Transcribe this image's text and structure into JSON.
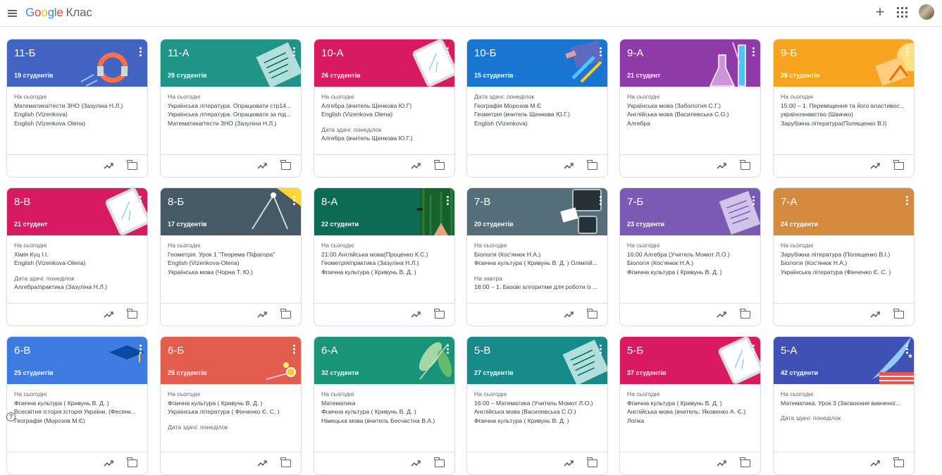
{
  "header": {
    "logo_google": [
      "G",
      "o",
      "o",
      "g",
      "l",
      "e"
    ],
    "app_name": "Клас",
    "add_label": "+"
  },
  "colors": {
    "topbar_border": "#e0e0e0",
    "card_border": "#dadce0"
  },
  "classes": [
    {
      "name": "11-Б",
      "count": "19 студентів",
      "color": "#4364c2",
      "deco": "magnet",
      "lines": [
        {
          "t": "lbl",
          "v": "На сьогодні"
        },
        {
          "t": "ln",
          "v": "Математика/тести ЗНО (Зазуліна Н.Л.)"
        },
        {
          "t": "ln",
          "v": "English (Vizenkova)"
        },
        {
          "t": "ln",
          "v": "English (Vizenkova Olena)"
        }
      ]
    },
    {
      "name": "11-А",
      "count": "29 студентів",
      "color": "#1f9487",
      "deco": "paper",
      "lines": [
        {
          "t": "lbl",
          "v": "На сьогодні"
        },
        {
          "t": "ln",
          "v": "Українська література. Опрацювати стр14..."
        },
        {
          "t": "ln",
          "v": "Українська література. Опрацювати за під..."
        },
        {
          "t": "ln",
          "v": "Математика/тести ЗНО (Зазуліна Н.Л.)"
        }
      ]
    },
    {
      "name": "10-А",
      "count": "26 студентів",
      "color": "#d81b60",
      "deco": "tablet",
      "lines": [
        {
          "t": "lbl",
          "v": "На сьогодні"
        },
        {
          "t": "ln",
          "v": "Алгебра (вчитель Щенкова Ю.Г)"
        },
        {
          "t": "ln",
          "v": "English (Vizenkova Olena)"
        },
        {
          "t": "gap",
          "v": ""
        },
        {
          "t": "lbl",
          "v": "Дата здачі: понеділок"
        },
        {
          "t": "ln",
          "v": "Алгебра (вчитель Щенкова Ю.Г.)"
        }
      ]
    },
    {
      "name": "10-Б",
      "count": "15 студентів",
      "color": "#1976d2",
      "deco": "pencils",
      "lines": [
        {
          "t": "lbl",
          "v": "Дата здачі: понеділок"
        },
        {
          "t": "ln",
          "v": "Географія Морозов М.Є"
        },
        {
          "t": "ln",
          "v": "Геометрія (вчитель Щенкова Ю.Г.)"
        },
        {
          "t": "ln",
          "v": "English (Vizenkova)"
        }
      ]
    },
    {
      "name": "9-А",
      "count": "21 студент",
      "color": "#8e3aa9",
      "deco": "flask",
      "lines": [
        {
          "t": "lbl",
          "v": "На сьогодні"
        },
        {
          "t": "ln",
          "v": "Українська мова (Заболотня С.Г.)"
        },
        {
          "t": "ln",
          "v": "Англійська мова (Василевська С.О.)"
        },
        {
          "t": "ln",
          "v": "Алгебра"
        }
      ]
    },
    {
      "name": "9-Б",
      "count": "26 студентів",
      "color": "#f6a41f",
      "deco": "sun",
      "lines": [
        {
          "t": "lbl",
          "v": "На сьогодні"
        },
        {
          "t": "ln",
          "v": "15:00 – 1. Переміщення та його властивос..."
        },
        {
          "t": "ln",
          "v": "українознавство (Швачко)"
        },
        {
          "t": "ln",
          "v": "Зарубіжна література(Полященко В.І)"
        }
      ]
    },
    {
      "name": "8-В",
      "count": "21 студент",
      "color": "#d81b60",
      "deco": "tablet",
      "lines": [
        {
          "t": "lbl",
          "v": "На сьогодні"
        },
        {
          "t": "ln",
          "v": "Хімія Куц І.І."
        },
        {
          "t": "ln",
          "v": "English (Vizenkova-Olena)"
        },
        {
          "t": "gap",
          "v": ""
        },
        {
          "t": "lbl",
          "v": "Дата здачі: понеділок"
        },
        {
          "t": "ln",
          "v": "Алгебра/практика (Зазуліна Н.Л.)"
        }
      ]
    },
    {
      "name": "8-Б",
      "count": "17 студентів",
      "color": "#455a64",
      "deco": "compass",
      "lines": [
        {
          "t": "lbl",
          "v": "На сьогодні"
        },
        {
          "t": "ln",
          "v": "Геометрія. Урок 1 \"Теорема Піфагора\""
        },
        {
          "t": "ln",
          "v": "English (Vizenkova-Olena)"
        },
        {
          "t": "ln",
          "v": "Українська мова (Чорна Т. Ю.)"
        }
      ]
    },
    {
      "name": "8-А",
      "count": "22 студенти",
      "color": "#0b6b54",
      "deco": "forest",
      "lines": [
        {
          "t": "lbl",
          "v": "На сьогодні"
        },
        {
          "t": "ln",
          "v": "21:00    Англійська мова(Проценко К.С.)"
        },
        {
          "t": "ln",
          "v": "Геометрія/практика (Зазуліна Н.Л.)"
        },
        {
          "t": "ln",
          "v": "Фізична культура ( Кривунь В. Д. )"
        }
      ]
    },
    {
      "name": "7-В",
      "count": "20 студентів",
      "color": "#546e7a",
      "deco": "devices",
      "lines": [
        {
          "t": "lbl",
          "v": "На сьогодні"
        },
        {
          "t": "ln",
          "v": "Біологія (Кос'янюк Н.А.)"
        },
        {
          "t": "ln",
          "v": "Фізична культура ( Кривунь В. Д. ) Олімпій..."
        },
        {
          "t": "gap",
          "v": ""
        },
        {
          "t": "lbl",
          "v": "На завтра"
        },
        {
          "t": "ln",
          "v": "18:00 – 1. Базові алгоритми для роботи із ..."
        }
      ]
    },
    {
      "name": "7-Б",
      "count": "23 студенти",
      "color": "#7b5ab5",
      "deco": "notebook",
      "lines": [
        {
          "t": "lbl",
          "v": "На сьогодні"
        },
        {
          "t": "ln",
          "v": "16:00    Алгебра (Учитель Момот Л.О.)"
        },
        {
          "t": "ln",
          "v": "Біологія (Кос'янюк Н.А.)"
        },
        {
          "t": "ln",
          "v": "Фізична культура ( Кривунь В. Д. )"
        }
      ]
    },
    {
      "name": "7-А",
      "count": "24 студенти",
      "color": "#d58b3f",
      "deco": "none",
      "lines": [
        {
          "t": "lbl",
          "v": "На сьогодні"
        },
        {
          "t": "ln",
          "v": "Зарубіжна література (Полященко В.І.)"
        },
        {
          "t": "ln",
          "v": "Біологія (Кос'янюк Н.А.)"
        },
        {
          "t": "ln",
          "v": "Українська література (Фінченко Є. С. )"
        }
      ]
    },
    {
      "name": "6-В",
      "count": "25 студентів",
      "color": "#3d7be0",
      "deco": "cap",
      "lines": [
        {
          "t": "lbl",
          "v": "На сьогодні"
        },
        {
          "t": "ln",
          "v": "Фізична культура ( Кривунь В. Д. )"
        },
        {
          "t": "ln",
          "v": "Всесвітня історія.Історія України. (Фесенк..."
        },
        {
          "t": "ln",
          "v": "Географія (Морозов М.Є)"
        }
      ]
    },
    {
      "name": "6-Б",
      "count": "25 студентів",
      "color": "#e35d4f",
      "deco": "pins",
      "lines": [
        {
          "t": "lbl",
          "v": "На сьогодні"
        },
        {
          "t": "ln",
          "v": "Фізична культура ( Кривунь В. Д. )"
        },
        {
          "t": "ln",
          "v": "Українська література ( Фінченко Є. С. )"
        },
        {
          "t": "gap",
          "v": ""
        },
        {
          "t": "lbl",
          "v": "Дата здачі: понеділок"
        }
      ]
    },
    {
      "name": "6-А",
      "count": "32 студенти",
      "color": "#1a9479",
      "deco": "leaves",
      "lines": [
        {
          "t": "lbl",
          "v": "На сьогодні"
        },
        {
          "t": "ln",
          "v": "Математика"
        },
        {
          "t": "ln",
          "v": "Фізична культура ( Кривунь В. Д. )"
        },
        {
          "t": "ln",
          "v": "Німецька мова (вчитель Бесчастна В.А.)"
        }
      ]
    },
    {
      "name": "5-В",
      "count": "27 студентів",
      "color": "#168a8a",
      "deco": "paper",
      "lines": [
        {
          "t": "lbl",
          "v": "На сьогодні"
        },
        {
          "t": "ln",
          "v": "16:00 – Математика (Учитель Момот Л.О.)"
        },
        {
          "t": "ln",
          "v": "Англійська мова (Василевська С.О.)"
        },
        {
          "t": "ln",
          "v": "Фізична культура ( Кривунь В. Д. )"
        }
      ]
    },
    {
      "name": "5-Б",
      "count": "37 студентів",
      "color": "#d81b60",
      "deco": "tablet",
      "lines": [
        {
          "t": "lbl",
          "v": "На сьогодні"
        },
        {
          "t": "ln",
          "v": "Фізична культура ( Кривунь В. Д. )"
        },
        {
          "t": "ln",
          "v": "Англійська мова (вчитель: Яковенко А. Є.)"
        },
        {
          "t": "ln",
          "v": "Логіка"
        }
      ]
    },
    {
      "name": "5-А",
      "count": "42 студенти",
      "color": "#3f51b5",
      "deco": "quill",
      "lines": [
        {
          "t": "lbl",
          "v": "На сьогодні"
        },
        {
          "t": "ln",
          "v": "Математика. Урок 3 (Засвоєння вивченог..."
        },
        {
          "t": "gap",
          "v": ""
        },
        {
          "t": "lbl",
          "v": "Дата здачі: понеділок"
        }
      ]
    }
  ]
}
